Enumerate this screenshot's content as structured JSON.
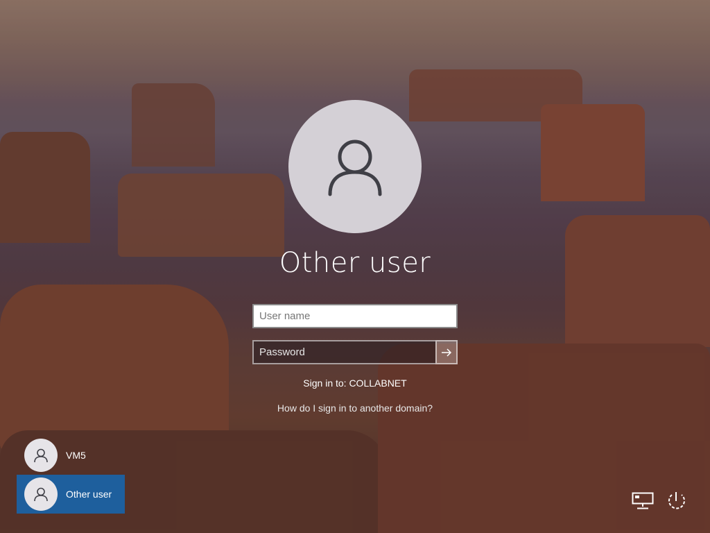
{
  "login": {
    "title": "Other user",
    "username_placeholder": "User name",
    "password_placeholder": "Password",
    "sign_in_to": "Sign in to: COLLABNET",
    "help_link": "How do I sign in to another domain?",
    "submit_icon": "arrow-right-icon"
  },
  "users": [
    {
      "name": "VM5",
      "icon": "user-icon",
      "selected": false
    },
    {
      "name": "Other user",
      "icon": "user-icon",
      "selected": true
    }
  ],
  "system_icons": {
    "network": "network-icon",
    "power": "power-icon"
  },
  "colors": {
    "selected_user_bg": "#1e5f9d",
    "avatar_bg": "#d4d0d6",
    "avatar_glyph": "#3f3f46"
  }
}
